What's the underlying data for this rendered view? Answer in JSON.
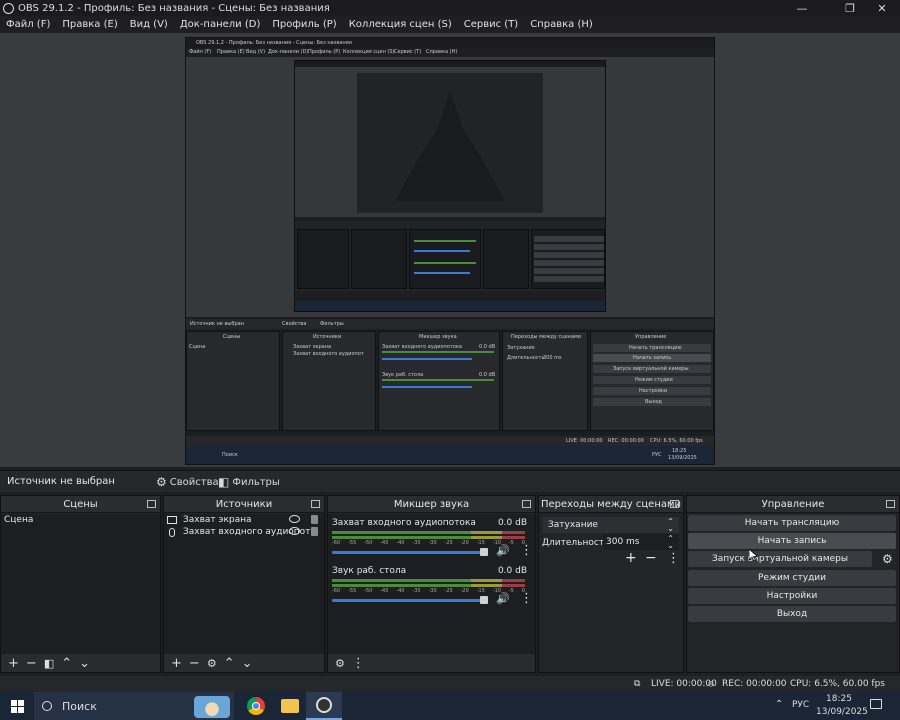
{
  "window": {
    "title": "OBS 29.1.2 - Профиль: Без названия - Сцены: Без названия",
    "minimize": "—",
    "maximize": "❐",
    "close": "✕"
  },
  "menu": [
    "Файл (F)",
    "Правка (E)",
    "Вид (V)",
    "Док-панели (D)",
    "Профиль (P)",
    "Коллекция сцен (S)",
    "Сервис (T)",
    "Справка (H)"
  ],
  "nested_window": {
    "title": "OBS 29.1.2 - Профиль: Без названия - Сцены: Без названия",
    "menu": [
      "Файл (F)",
      "Правка (E)",
      "Вид (V)",
      "Док-панели (D)",
      "Профиль (P)",
      "Коллекция сцен (S)",
      "Сервис (T)",
      "Справка (H)"
    ],
    "source_bar": {
      "label": "Источник не выбран",
      "properties": "Свойства",
      "filters": "Фильтры"
    },
    "docks": {
      "scenes": "Сцены",
      "sources": "Источники",
      "mixer": "Микшер звука",
      "transitions": "Переходы между сценами",
      "controls": "Управление"
    },
    "scene_item": "Сцена",
    "sources": [
      "Захват экрана",
      "Захват входного аудиопот"
    ],
    "mixer": [
      {
        "name": "Захват входного аудиопотока",
        "db": "0.0 dB"
      },
      {
        "name": "Звук раб. стола",
        "db": "0.0 dB"
      }
    ],
    "transition": "Затухание",
    "duration_label": "Длительность",
    "duration": "300 ms",
    "controls": [
      "Начать трансляцию",
      "Начать запись",
      "Запуск виртуальной камеры",
      "Режим студии",
      "Настройки",
      "Выход"
    ],
    "status": {
      "live": "LIVE: 00:00:00",
      "rec": "REC: 00:00:00",
      "cpu": "CPU: 6.5%, 60.00 fps"
    },
    "taskbar": {
      "search": "Поиск",
      "lang": "РУС",
      "time": "18:25",
      "date": "13/09/2025"
    }
  },
  "source_bar": {
    "label": "Источник не выбран",
    "properties": "Свойства",
    "filters": "Фильтры",
    "gear_glyph": "⚙",
    "filters_glyph": "◧"
  },
  "scenes": {
    "title": "Сцены",
    "items": [
      "Сцена"
    ]
  },
  "sources": {
    "title": "Источники",
    "items": [
      {
        "label": "Захват экрана",
        "icon": "monitor-icon"
      },
      {
        "label": "Захват входного аудиопот",
        "icon": "microphone-icon"
      }
    ]
  },
  "mixer": {
    "title": "Микшер звука",
    "ticks": [
      "-60",
      "-55",
      "-50",
      "-45",
      "-40",
      "-35",
      "-30",
      "-25",
      "-20",
      "-15",
      "-10",
      "-5",
      "0"
    ],
    "channels": [
      {
        "name": "Захват входного аудиопотока",
        "db": "0.0 dB",
        "volume": 1.0
      },
      {
        "name": "Звук раб. стола",
        "db": "0.0 dB",
        "volume": 1.0
      }
    ]
  },
  "transitions": {
    "title": "Переходы между сценами",
    "selected": "Затухание",
    "duration_label": "Длительность",
    "duration_value": "300 ms"
  },
  "controls": {
    "title": "Управление",
    "start_stream": "Начать трансляцию",
    "start_record": "Начать запись",
    "virtual_camera": "Запуск виртуальной камеры",
    "studio_mode": "Режим студии",
    "settings": "Настройки",
    "exit": "Выход"
  },
  "footer_glyphs": {
    "add": "+",
    "remove": "−",
    "filter": "◧",
    "up": "⌃",
    "down": "⌄",
    "gear": "⚙",
    "more": "⋮"
  },
  "status": {
    "live": "LIVE: 00:00:00",
    "rec": "REC: 00:00:00",
    "cpu": "CPU: 6.5%, 60.00 fps"
  },
  "taskbar": {
    "search": "Поиск",
    "lang": "РУС",
    "time": "18:25",
    "date": "13/09/2025"
  },
  "colors": {
    "accent": "#3b7bd6",
    "panel": "#232428",
    "background": "#1e1f22"
  }
}
